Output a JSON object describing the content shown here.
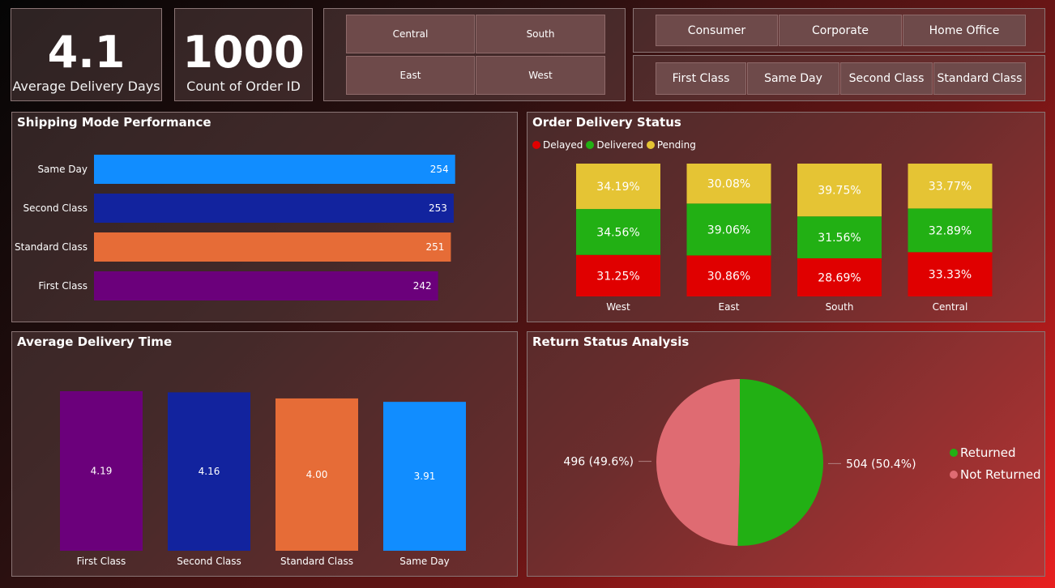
{
  "kpis": [
    {
      "value": "4.1",
      "label": "Average Delivery Days"
    },
    {
      "value": "1000",
      "label": "Count of Order ID"
    }
  ],
  "region_slicer": [
    "Central",
    "South",
    "East",
    "West"
  ],
  "segment_slicer": [
    "Consumer",
    "Corporate",
    "Home Office"
  ],
  "shipmode_slicer": [
    "First Class",
    "Same Day",
    "Second Class",
    "Standard Class"
  ],
  "shipping_panel": {
    "title": "Shipping Mode Performance"
  },
  "status_panel": {
    "title": "Order Delivery Status"
  },
  "avg_panel": {
    "title": "Average Delivery Time"
  },
  "return_panel": {
    "title": "Return Status Analysis"
  },
  "chart_data": [
    {
      "type": "bar",
      "orientation": "horizontal",
      "title": "Shipping Mode Performance",
      "categories": [
        "Same Day",
        "Second Class",
        "Standard Class",
        "First Class"
      ],
      "values": [
        254,
        253,
        251,
        242
      ],
      "colors": [
        "#118dff",
        "#12239e",
        "#e66c37",
        "#6b007b"
      ],
      "xlim": [
        0,
        265
      ]
    },
    {
      "type": "bar",
      "stacked": "100%",
      "title": "Order Delivery Status",
      "categories": [
        "West",
        "East",
        "South",
        "Central"
      ],
      "legend": "top-left",
      "series": [
        {
          "name": "Delayed",
          "color": "#e00000",
          "values": [
            31.25,
            30.86,
            28.69,
            33.33
          ],
          "labels": [
            "31.25%",
            "30.86%",
            "28.69%",
            "33.33%"
          ]
        },
        {
          "name": "Delivered",
          "color": "#22b014",
          "values": [
            34.56,
            39.06,
            31.56,
            32.89
          ],
          "labels": [
            "34.56%",
            "39.06%",
            "31.56%",
            "32.89%"
          ]
        },
        {
          "name": "Pending",
          "color": "#e5c434",
          "values": [
            34.19,
            30.08,
            39.75,
            33.77
          ],
          "labels": [
            "34.19%",
            "30.08%",
            "39.75%",
            "33.77%"
          ]
        }
      ]
    },
    {
      "type": "bar",
      "title": "Average Delivery Time",
      "categories": [
        "First Class",
        "Second Class",
        "Standard Class",
        "Same Day"
      ],
      "values": [
        4.19,
        4.16,
        4.0,
        3.91
      ],
      "labels": [
        "4.19",
        "4.16",
        "4.00",
        "3.91"
      ],
      "colors": [
        "#6b007b",
        "#12239e",
        "#e66c37",
        "#118dff"
      ],
      "ylim": [
        0,
        4.19
      ]
    },
    {
      "type": "pie",
      "title": "Return Status Analysis",
      "legend": "right",
      "slices": [
        {
          "name": "Returned",
          "value": 504,
          "label": "504 (50.4%)",
          "color": "#22b014"
        },
        {
          "name": "Not Returned",
          "value": 496,
          "label": "496 (49.6%)",
          "color": "#df6b72"
        }
      ]
    }
  ]
}
